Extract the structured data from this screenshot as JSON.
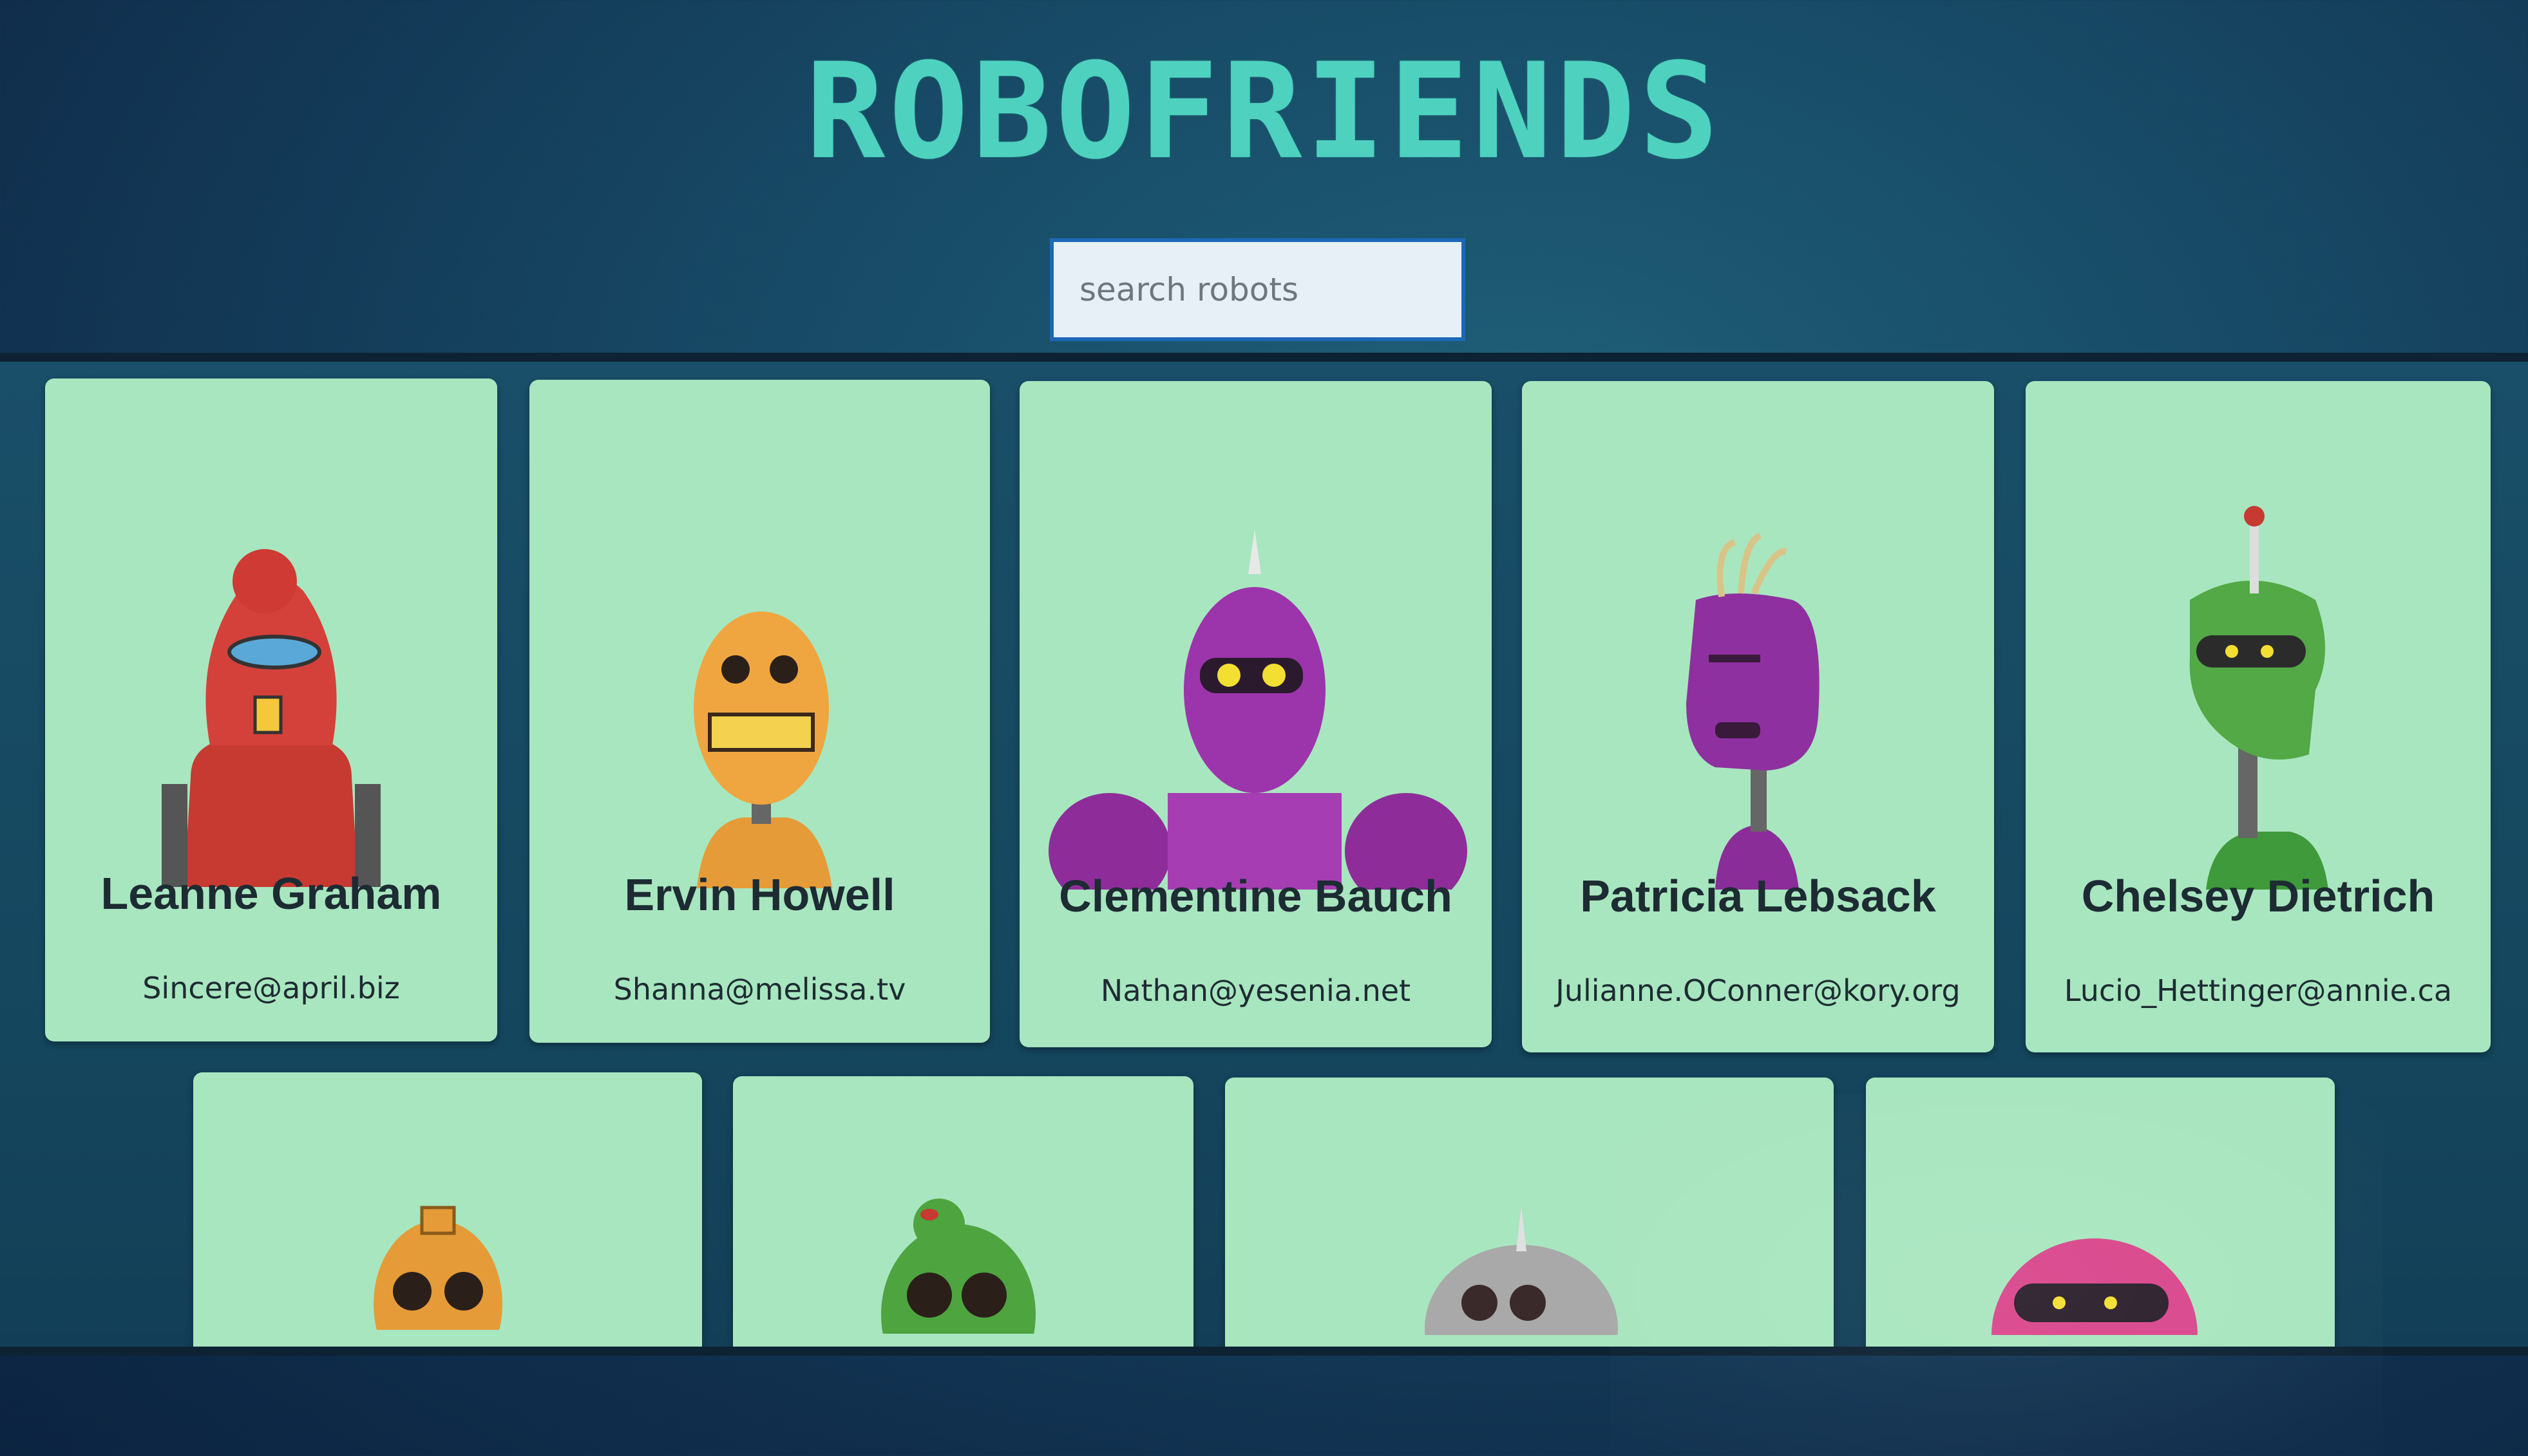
{
  "app": {
    "title": "ROBOFRIENDS"
  },
  "search": {
    "placeholder": "search robots",
    "value": ""
  },
  "robots_row1": [
    {
      "name": "Leanne Graham",
      "email": "Sincere@april.biz"
    },
    {
      "name": "Ervin Howell",
      "email": "Shanna@melissa.tv"
    },
    {
      "name": "Clementine Bauch",
      "email": "Nathan@yesenia.net"
    },
    {
      "name": "Patricia Lebsack",
      "email": "Julianne.OConner@kory.org"
    },
    {
      "name": "Chelsey Dietrich",
      "email": "Lucio_Hettinger@annie.ca"
    }
  ],
  "colors": {
    "background": "#174a66",
    "title": "#4ed2bf",
    "card": "#a8e6bf",
    "search_border": "#1c68b5"
  },
  "icons": {
    "robot_avatars_row1": [
      "red-robot-icon",
      "orange-robot-icon",
      "purple-robot-icon",
      "purple-robot-icon",
      "green-robot-icon"
    ],
    "robot_avatars_row2": [
      "orange-robot-icon",
      "green-robot-icon",
      "gray-robot-icon",
      "pink-robot-icon"
    ]
  }
}
